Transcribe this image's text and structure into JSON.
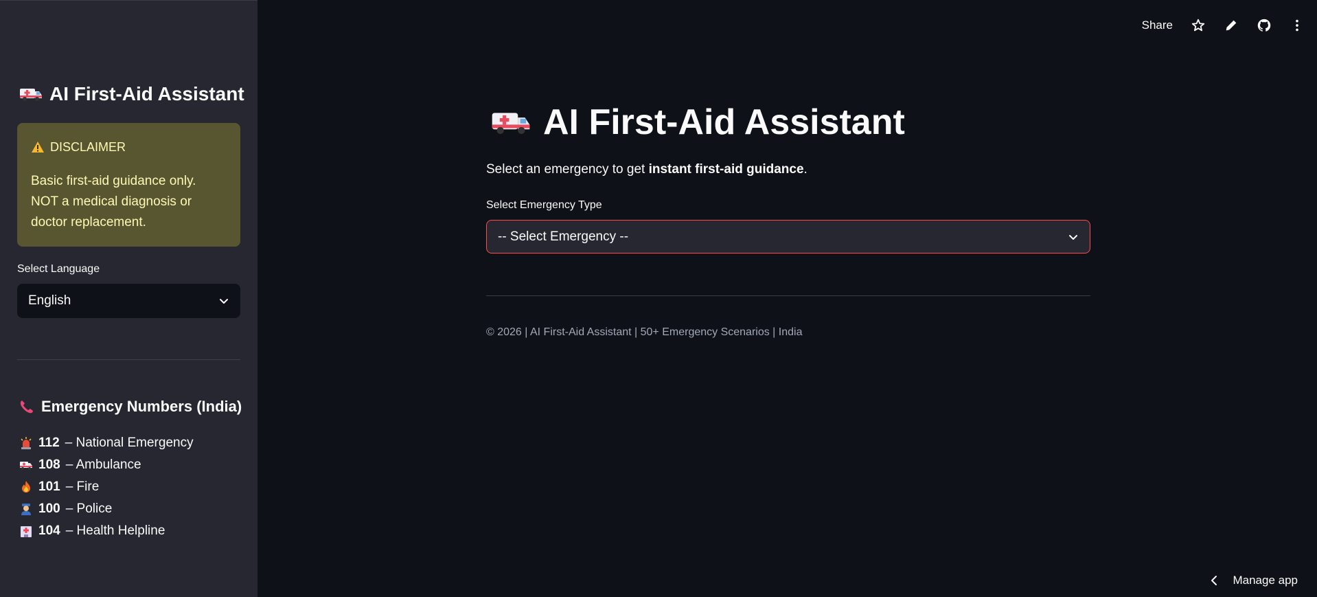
{
  "sidebar": {
    "title": "AI First-Aid Assistant",
    "disclaimer": {
      "heading": "DISCLAIMER",
      "text": "Basic first-aid guidance only. NOT a medical diagnosis or doctor replacement."
    },
    "language": {
      "label": "Select Language",
      "selected": "English"
    },
    "emergency_numbers": {
      "title": "Emergency Numbers (India)",
      "items": [
        {
          "number": "112",
          "label": "– National Emergency",
          "icon": "siren-icon"
        },
        {
          "number": "108",
          "label": "– Ambulance",
          "icon": "ambulance-icon"
        },
        {
          "number": "101",
          "label": "– Fire",
          "icon": "fire-icon"
        },
        {
          "number": "100",
          "label": "– Police",
          "icon": "police-icon"
        },
        {
          "number": "104",
          "label": "– Health Helpline",
          "icon": "hospital-icon"
        }
      ]
    }
  },
  "toolbar": {
    "share_label": "Share"
  },
  "main": {
    "title": "AI First-Aid Assistant",
    "subtitle_prefix": "Select an emergency to get ",
    "subtitle_bold": "instant first-aid guidance",
    "subtitle_suffix": ".",
    "select_label": "Select Emergency Type",
    "select_value": "-- Select Emergency --",
    "footer": "© 2026 | AI First-Aid Assistant | 50+ Emergency Scenarios | India"
  },
  "manage_app_label": "Manage app",
  "colors": {
    "background": "#0e1117",
    "sidebar": "#262730",
    "accent": "#ff4b4b",
    "disclaimer_bg": "#575631",
    "disclaimer_text": "#fff8b3"
  }
}
